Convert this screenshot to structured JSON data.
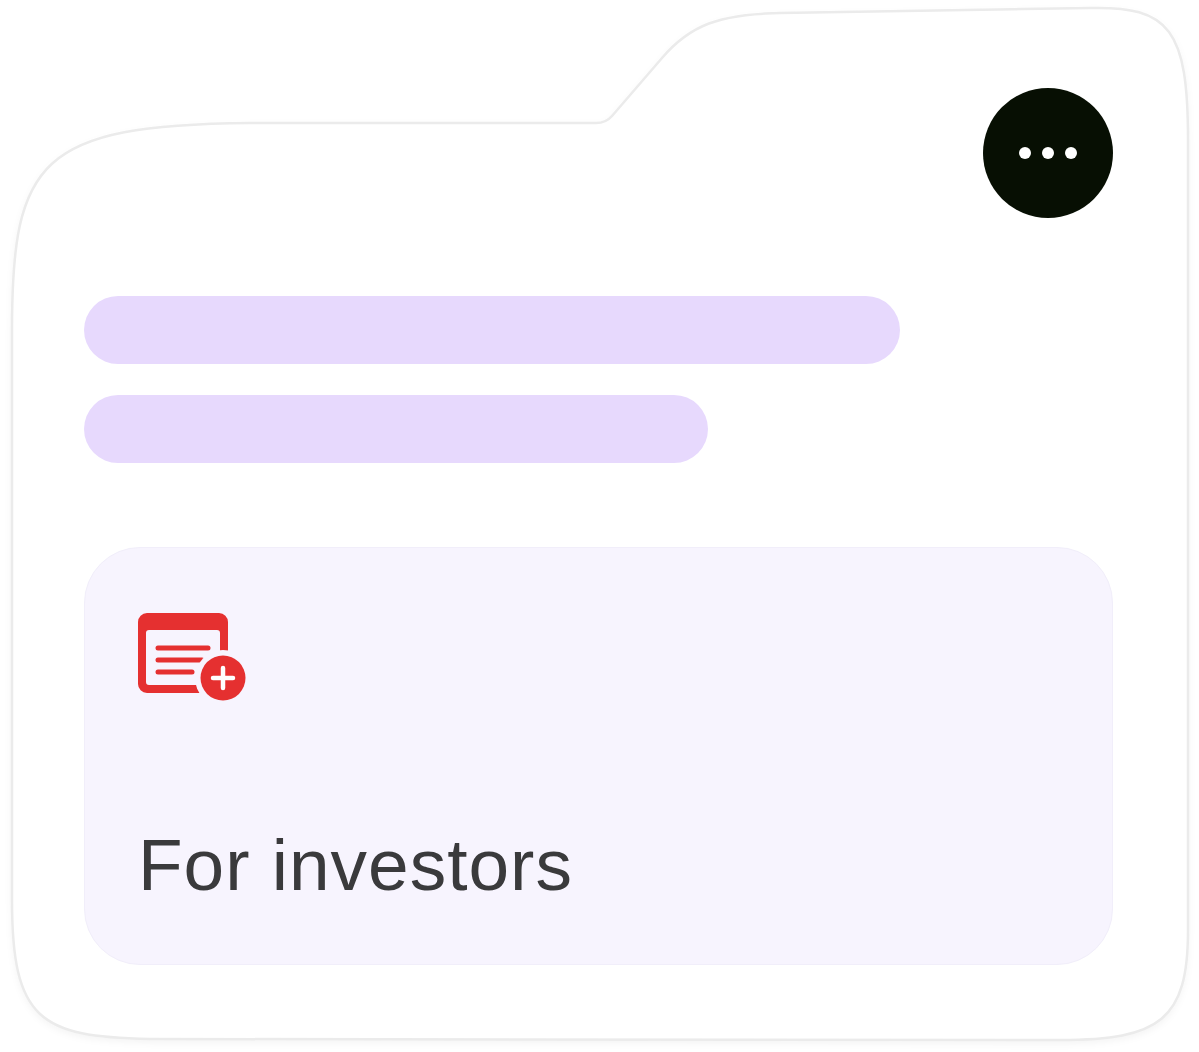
{
  "skeleton_lines": [
    {
      "kind": "long"
    },
    {
      "kind": "short"
    }
  ],
  "card": {
    "title": "For investors"
  }
}
